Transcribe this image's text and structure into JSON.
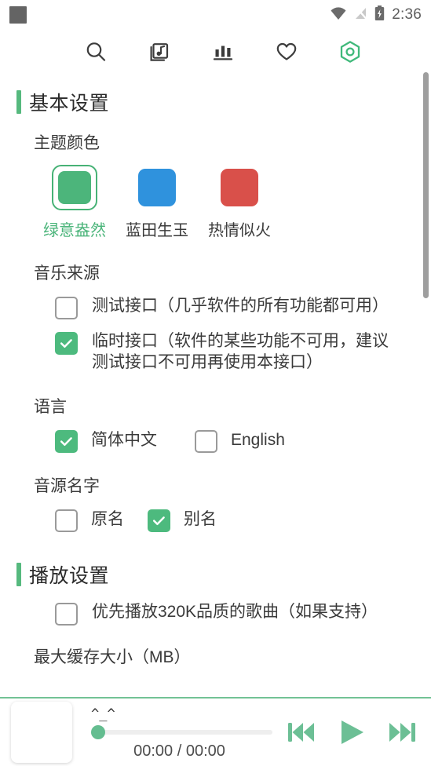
{
  "status_bar": {
    "time": "2:36",
    "icons": [
      "notification-square-icon",
      "wifi-icon",
      "signal-off-icon",
      "battery-charging-icon"
    ]
  },
  "toolbar": {
    "items": [
      {
        "name": "search-icon",
        "label": "搜索"
      },
      {
        "name": "song-list-icon",
        "label": "歌单"
      },
      {
        "name": "leaderboard-icon",
        "label": "排行榜"
      },
      {
        "name": "favorite-heart-icon",
        "label": "收藏"
      },
      {
        "name": "settings-hex-icon",
        "label": "设置"
      }
    ],
    "active_index": 4
  },
  "sections": [
    {
      "title": "基本设置",
      "groups": [
        {
          "label": "主题颜色",
          "type": "swatches",
          "options": [
            {
              "name": "绿意盎然",
              "color": "#4cb57b",
              "selected": true
            },
            {
              "name": "蓝田生玉",
              "color": "#2f92dd",
              "selected": false
            },
            {
              "name": "热情似火",
              "color": "#d9504a",
              "selected": false
            }
          ]
        },
        {
          "label": "音乐来源",
          "type": "checkbox-stack",
          "options": [
            {
              "label": "测试接口（几乎软件的所有功能都可用）",
              "checked": false
            },
            {
              "label": "临时接口（软件的某些功能不可用，建议测试接口不可用再使用本接口）",
              "checked": true
            }
          ]
        },
        {
          "label": "语言",
          "type": "checkbox-inline",
          "options": [
            {
              "label": "简体中文",
              "checked": true
            },
            {
              "label": "English",
              "checked": false
            }
          ]
        },
        {
          "label": "音源名字",
          "type": "checkbox-inline",
          "options": [
            {
              "label": "原名",
              "checked": false
            },
            {
              "label": "别名",
              "checked": true
            }
          ]
        }
      ]
    },
    {
      "title": "播放设置",
      "groups": [
        {
          "label": "",
          "type": "checkbox-stack",
          "options": [
            {
              "label": "优先播放320K品质的歌曲（如果支持）",
              "checked": false
            }
          ]
        },
        {
          "label": "最大缓存大小（MB）",
          "type": "label-only",
          "options": []
        }
      ]
    }
  ],
  "player": {
    "song_title": "^_^",
    "time_display": "00:00 / 00:00",
    "progress_percent": 0,
    "controls": [
      {
        "name": "previous-track-button",
        "label": "上一首"
      },
      {
        "name": "play-button",
        "label": "播放"
      },
      {
        "name": "next-track-button",
        "label": "下一首"
      }
    ]
  },
  "colors": {
    "accent": "#4cb57b",
    "accent_bar": "#56b97e",
    "player_border": "#72c295",
    "scrollbar": "#9e9e9e"
  }
}
